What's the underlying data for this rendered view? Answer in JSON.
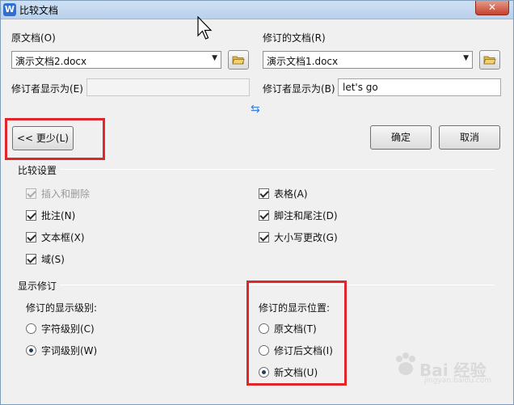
{
  "window": {
    "title": "比较文档",
    "app_icon": "W",
    "close_glyph": "✕"
  },
  "original": {
    "label": "原文档(O)",
    "file": "演示文档2.docx",
    "reviewer_label": "修订者显示为(E)",
    "reviewer_value": ""
  },
  "revised": {
    "label": "修订的文档(R)",
    "file": "演示文档1.docx",
    "reviewer_label": "修订者显示为(B)",
    "reviewer_value": "let's go"
  },
  "buttons": {
    "less": "<< 更少(L)",
    "ok": "确定",
    "cancel": "取消"
  },
  "compare_settings": {
    "title": "比较设置",
    "insert_delete": {
      "label": "插入和删除",
      "checked": true,
      "disabled": true
    },
    "comments": {
      "label": "批注(N)",
      "checked": true
    },
    "textbox": {
      "label": "文本框(X)",
      "checked": true
    },
    "fields": {
      "label": "域(S)",
      "checked": true
    },
    "tables": {
      "label": "表格(A)",
      "checked": true
    },
    "footnotes": {
      "label": "脚注和尾注(D)",
      "checked": true
    },
    "case_changes": {
      "label": "大小写更改(G)",
      "checked": true
    }
  },
  "show_changes": {
    "title": "显示修订",
    "level_title": "修订的显示级别:",
    "char_level": {
      "label": "字符级别(C)",
      "selected": false
    },
    "word_level": {
      "label": "字词级别(W)",
      "selected": true
    },
    "location_title": "修订的显示位置:",
    "loc_original": {
      "label": "原文档(T)",
      "selected": false
    },
    "loc_revised": {
      "label": "修订后文档(I)",
      "selected": false
    },
    "loc_new": {
      "label": "新文档(U)",
      "selected": true
    }
  },
  "watermark": {
    "text": "Bai 经验",
    "sub": "jingyan.baidu.com"
  },
  "colors": {
    "highlight": "#e0252b",
    "accent": "#3d7fd6"
  }
}
